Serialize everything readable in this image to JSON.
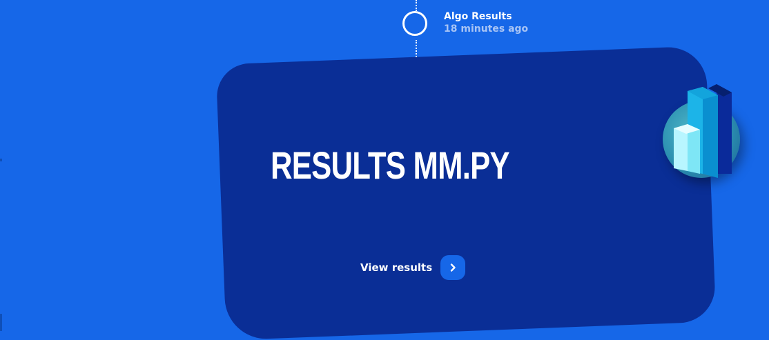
{
  "timeline": {
    "event": {
      "title": "Algo Results",
      "time": "18 minutes ago"
    }
  },
  "card": {
    "title": "RESULTS MM.PY",
    "action_label": "View results",
    "action_icon": "chevron-right-icon",
    "badge_icon": "bar-chart-3d-icon"
  },
  "colors": {
    "background": "#1667E8",
    "card": "#0A2E96",
    "accent_button": "#1667E8",
    "muted_text": "#A8C4F5"
  }
}
